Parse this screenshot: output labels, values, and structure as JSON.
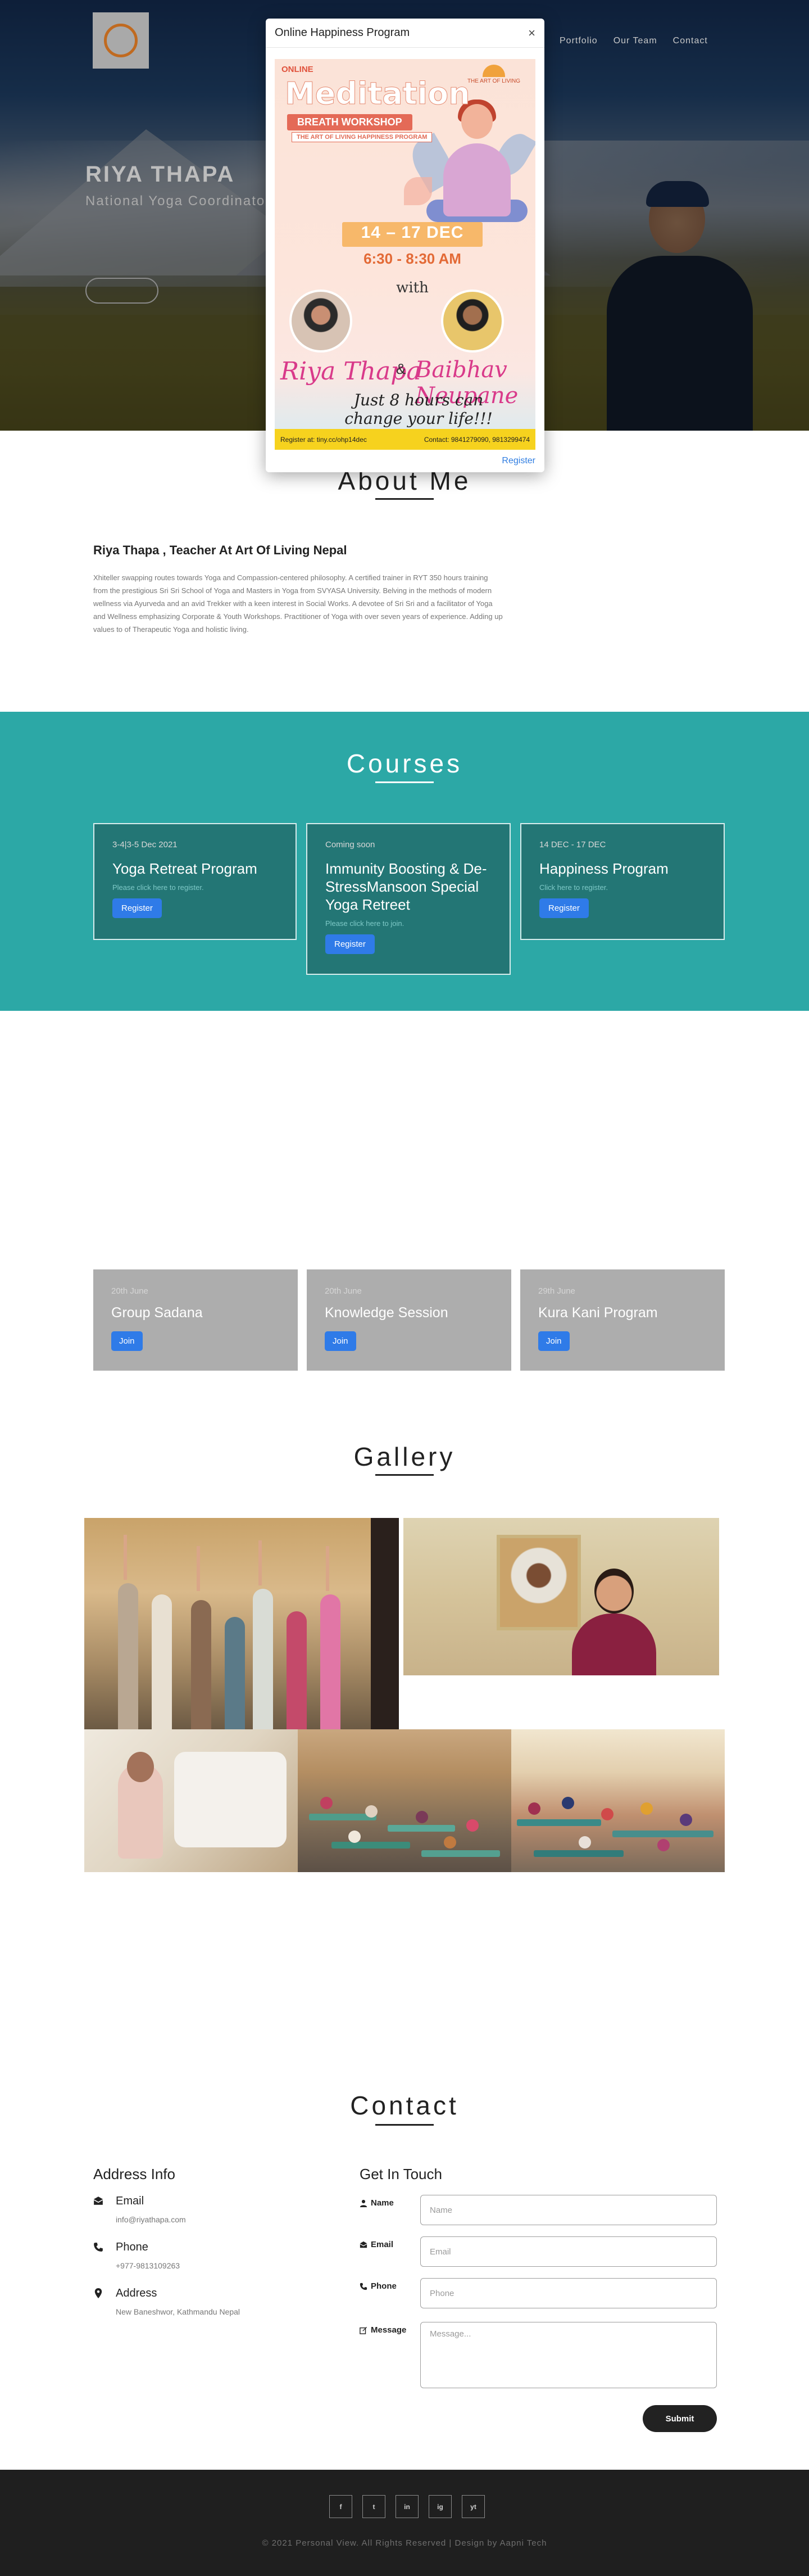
{
  "header": {
    "nav": [
      "Portfolio",
      "Our Team",
      "Contact"
    ]
  },
  "hero": {
    "name": "RIYA THAPA",
    "role": "National Yoga Coordinator N"
  },
  "modal": {
    "title": "Online Happiness Program",
    "close": "×",
    "register_link": "Register",
    "poster": {
      "online": "ONLINE",
      "org": "THE ART OF LIVING",
      "headline": "Meditation",
      "sub": "BREATH WORKSHOP",
      "program": "THE ART OF LIVING HAPPINESS PROGRAM",
      "dates": "14 – 17 DEC",
      "time": "6:30 - 8:30 AM",
      "with": "with",
      "teacher1": "Riya Thapa",
      "amp": "&",
      "teacher2": "Baibhav Neupane",
      "tagline": "Just 8 hours can change your life!!!",
      "register_at": "Register at: tiny.cc/ohp14dec",
      "contact": "Contact: 9841279090, 9813299474"
    }
  },
  "about": {
    "title": "About Me",
    "heading": "Riya Thapa , Teacher At Art Of Living Nepal",
    "text": "Xhiteller swapping routes towards Yoga and Compassion-centered philosophy. A certified trainer in RYT 350 hours training from the prestigious Sri Sri School of Yoga and Masters in Yoga from SVYASA University. Belving in the methods of modern wellness via Ayurveda and an avid Trekker with a keen interest in Social Works. A devotee of Sri Sri and a facilitator of Yoga and Wellness emphasizing Corporate & Youth Workshops. Practitioner of Yoga with over seven years of experience. Adding up values to of Therapeutic Yoga and holistic living."
  },
  "courses": {
    "title": "Courses",
    "items": [
      {
        "date": "3-4|3-5 Dec 2021",
        "name": "Yoga Retreat Program",
        "hint": "Please click here to register.",
        "button": "Register"
      },
      {
        "date": "Coming soon",
        "name": "Immunity Boosting & De-StressMansoon Special Yoga Retreet",
        "hint": "Please click here to join.",
        "button": "Register"
      },
      {
        "date": "14 DEC - 17 DEC",
        "name": "Happiness Program",
        "hint": "Click here to register.",
        "button": "Register"
      }
    ]
  },
  "events": {
    "items": [
      {
        "date": "20th June",
        "name": "Group Sadana",
        "button": "Join"
      },
      {
        "date": "20th June",
        "name": "Knowledge Session",
        "button": "Join"
      },
      {
        "date": "29th June",
        "name": "Kura Kani Program",
        "button": "Join"
      }
    ]
  },
  "gallery": {
    "title": "Gallery"
  },
  "contact": {
    "title": "Contact",
    "address_title": "Address Info",
    "info": [
      {
        "icon": "envelope-icon",
        "label": "Email",
        "value": "info@riyathapa.com"
      },
      {
        "icon": "phone-icon",
        "label": "Phone",
        "value": "+977-9813109263"
      },
      {
        "icon": "map-marker-icon",
        "label": "Address",
        "value": "New Baneshwor, Kathmandu Nepal"
      }
    ],
    "form_title": "Get In Touch",
    "form": {
      "name_label": "Name",
      "name_placeholder": "Name",
      "email_label": "Email",
      "email_placeholder": "Email",
      "phone_label": "Phone",
      "phone_placeholder": "Phone",
      "message_label": "Message",
      "message_placeholder": "Message...",
      "submit": "Submit"
    }
  },
  "footer": {
    "socials": [
      "f",
      "t",
      "in",
      "ig",
      "yt"
    ],
    "copyright": "© 2021 Personal View. All Rights Reserved | Design by Aapni Tech"
  },
  "colors": {
    "teal": "#2ca8a6",
    "card_teal": "#237675",
    "button_blue": "#2f7be8",
    "footer": "#1f1f1f"
  }
}
